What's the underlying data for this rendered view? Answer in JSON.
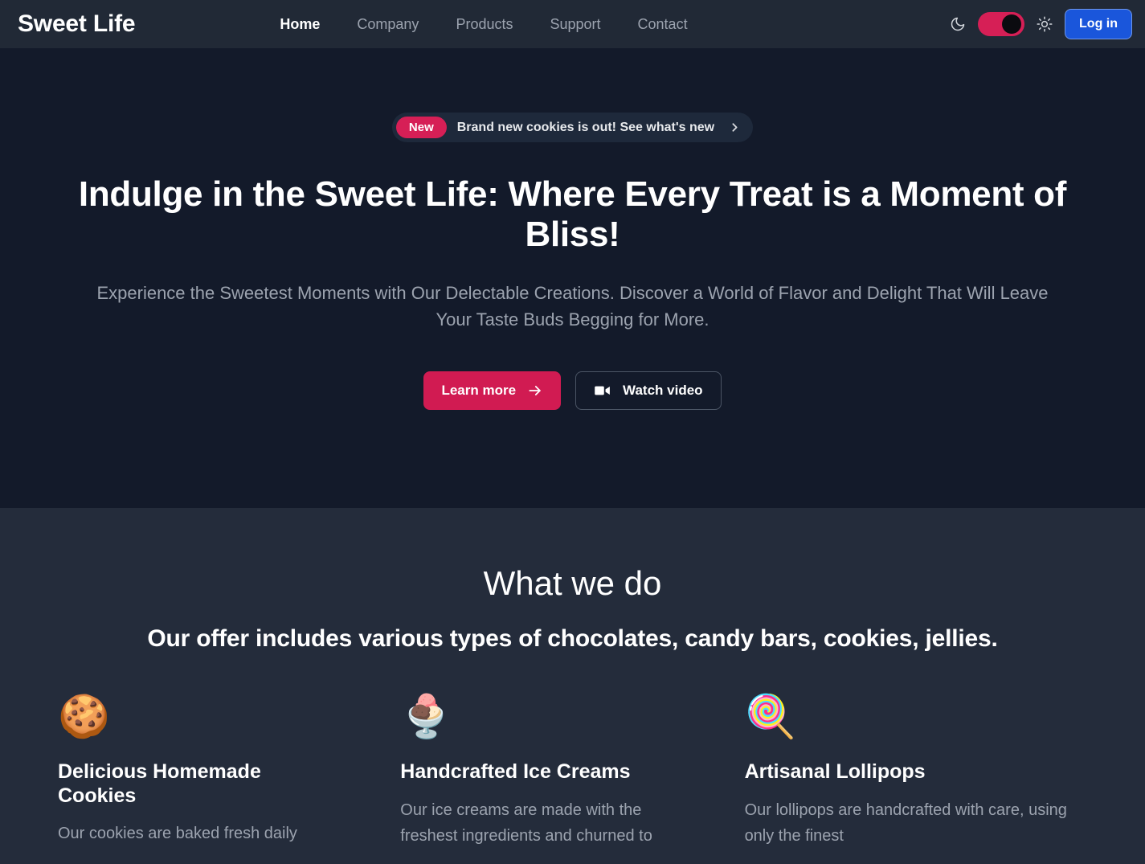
{
  "navbar": {
    "logo": "Sweet Life",
    "links": [
      {
        "label": "Home",
        "active": true
      },
      {
        "label": "Company",
        "active": false
      },
      {
        "label": "Products",
        "active": false
      },
      {
        "label": "Support",
        "active": false
      },
      {
        "label": "Contact",
        "active": false
      }
    ],
    "theme": {
      "moon_icon": "moon-icon",
      "sun_icon": "sun-icon",
      "toggle_state": "on",
      "toggle_color": "#d61f56"
    },
    "login_label": "Log in",
    "login_color": "#1a56db"
  },
  "hero": {
    "pill": {
      "badge": "New",
      "text": "Brand new cookies is out! See what's new",
      "chevron_icon": "chevron-right-icon",
      "badge_color": "#d61f56"
    },
    "title": "Indulge in the Sweet Life: Where Every Treat is a Moment of Bliss!",
    "subtitle": "Experience the Sweetest Moments with Our Delectable Creations. Discover a World of Flavor and Delight That Will Leave Your Taste Buds Begging for More.",
    "primary_button": {
      "label": "Learn more",
      "icon": "arrow-right-icon",
      "color": "#d11b52"
    },
    "secondary_button": {
      "label": "Watch video",
      "icon": "video-camera-icon"
    },
    "background_color": "#131a2a"
  },
  "what_we_do": {
    "title": "What we do",
    "subtitle": "Our offer includes various types of chocolates, candy bars, cookies, jellies.",
    "background_color": "#242c3b",
    "cards": [
      {
        "icon": "🍪",
        "icon_name": "cookie-icon",
        "title": "Delicious Homemade Cookies",
        "description": "Our cookies are baked fresh daily"
      },
      {
        "icon": "🍨",
        "icon_name": "ice-cream-icon",
        "title": "Handcrafted Ice Creams",
        "description": "Our ice creams are made with the freshest ingredients and churned to"
      },
      {
        "icon": "🍭",
        "icon_name": "lollipop-icon",
        "title": "Artisanal Lollipops",
        "description": "Our lollipops are handcrafted with care, using only the finest"
      }
    ]
  }
}
